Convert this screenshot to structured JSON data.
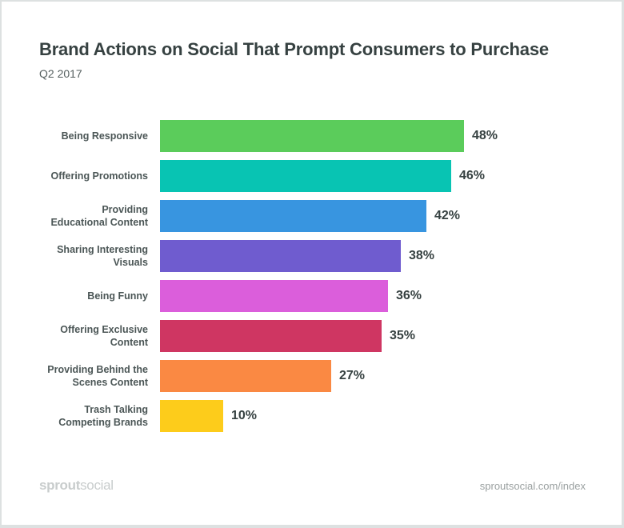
{
  "chart_data": {
    "type": "bar",
    "orientation": "horizontal",
    "title": "Brand Actions on Social That Prompt Consumers to Purchase",
    "subtitle": "Q2 2017",
    "xlabel": "",
    "ylabel": "",
    "grid": false,
    "legend": "none",
    "xlim": [
      0,
      48
    ],
    "unit": "%",
    "categories": [
      [
        "Being Responsive"
      ],
      [
        "Offering Promotions"
      ],
      [
        "Providing",
        "Educational Content"
      ],
      [
        "Sharing Interesting",
        "Visuals"
      ],
      [
        "Being Funny"
      ],
      [
        "Offering Exclusive",
        "Content"
      ],
      [
        "Providing Behind the",
        "Scenes Content"
      ],
      [
        "Trash Talking",
        "Competing Brands"
      ]
    ],
    "values": [
      48,
      46,
      42,
      38,
      36,
      35,
      27,
      10
    ],
    "value_labels": [
      "48%",
      "46%",
      "42%",
      "38%",
      "36%",
      "35%",
      "27%",
      "10%"
    ],
    "colors": [
      "#5bcc5b",
      "#08c4b3",
      "#3895e0",
      "#6f5ccf",
      "#db5edb",
      "#cf3662",
      "#fa8943",
      "#fdcc1b"
    ]
  },
  "footer": {
    "logo_bold": "sprout",
    "logo_light": "social",
    "source": "sproutsocial.com/index"
  }
}
